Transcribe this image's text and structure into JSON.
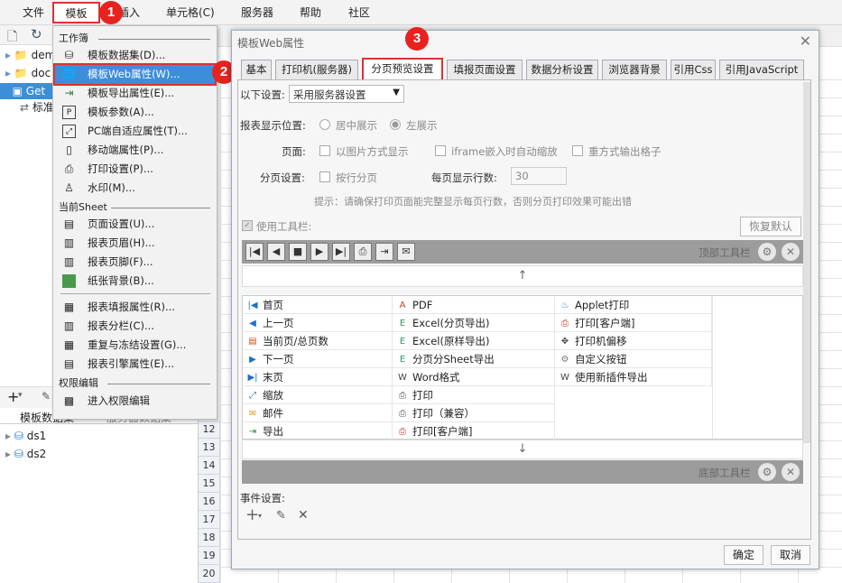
{
  "menubar": {
    "items": [
      "文件",
      "模板",
      "插入",
      "单元格(C)",
      "服务器",
      "帮助",
      "社区"
    ]
  },
  "callouts": [
    "1",
    "2",
    "3"
  ],
  "left": {
    "tree": [
      "dem",
      "doc",
      "Get",
      "标准"
    ],
    "tabs": [
      "模板数据集",
      "服务器数据集"
    ],
    "datasets": [
      "ds1",
      "ds2"
    ]
  },
  "sheet": {
    "rows": [
      "12",
      "13",
      "14",
      "15",
      "16",
      "17",
      "18",
      "19",
      "20"
    ]
  },
  "menu": {
    "section_workbook": "工作簿",
    "workbook_items": [
      {
        "label": "模板数据集(D)...",
        "icon": "database-icon"
      },
      {
        "label": "模板Web属性(W)...",
        "icon": "globe-icon"
      },
      {
        "label": "模板导出属性(E)...",
        "icon": "export-icon"
      },
      {
        "label": "模板参数(A)...",
        "icon": "param-icon"
      },
      {
        "label": "PC端自适应属性(T)...",
        "icon": "adapt-icon"
      },
      {
        "label": "移动端属性(P)...",
        "icon": "mobile-icon"
      },
      {
        "label": "打印设置(P)...",
        "icon": "printer-icon"
      },
      {
        "label": "水印(M)...",
        "icon": "stamp-icon"
      }
    ],
    "section_sheet": "当前Sheet",
    "sheet_items": [
      {
        "label": "页面设置(U)...",
        "icon": "page-icon"
      },
      {
        "label": "报表页眉(H)...",
        "icon": "header-icon"
      },
      {
        "label": "报表页脚(F)...",
        "icon": "footer-icon"
      },
      {
        "label": "纸张背景(B)...",
        "icon": "picture-icon"
      }
    ],
    "sheet_items2": [
      {
        "label": "报表填报属性(R)...",
        "icon": "form-icon"
      },
      {
        "label": "报表分栏(C)...",
        "icon": "columns-icon"
      },
      {
        "label": "重复与冻结设置(G)...",
        "icon": "freeze-icon"
      },
      {
        "label": "报表引擎属性(E)...",
        "icon": "engine-icon"
      }
    ],
    "section_perm": "权限编辑",
    "perm_item": {
      "label": "进入权限编辑",
      "icon": "permission-icon"
    }
  },
  "dialog": {
    "title": "模板Web属性",
    "tabs": [
      "基本",
      "打印机(服务器)",
      "分页预览设置",
      "填报页面设置",
      "数据分析设置",
      "浏览器背景",
      "引用Css",
      "引用JavaScript"
    ],
    "below_label": "以下设置:",
    "below_value": "采用服务器设置",
    "position_label": "报表显示位置:",
    "pos_center": "居中展示",
    "pos_left": "左展示",
    "page_label": "页面:",
    "page_img": "以图片方式显示",
    "page_iframe": "iframe嵌入时自动缩放",
    "page_repeat": "重方式输出格子",
    "paging_label": "分页设置:",
    "paging_row": "按行分页",
    "rows_label": "每页显示行数:",
    "rows_value": "30",
    "hint": "提示：请确保打印页面能完整显示每页行数，否则分页打印效果可能出错",
    "use_toolbar": "使用工具栏:",
    "restore": "恢复默认",
    "top_toolbar": "顶部工具栏",
    "bottom_toolbar": "底部工具栏",
    "event_label": "事件设置:",
    "ok": "确定",
    "cancel": "取消",
    "grid_col1": [
      {
        "label": "首页",
        "icon": "first-page-icon"
      },
      {
        "label": "上一页",
        "icon": "prev-page-icon"
      },
      {
        "label": "当前页/总页数",
        "icon": "page-count-icon"
      },
      {
        "label": "下一页",
        "icon": "next-page-icon"
      },
      {
        "label": "末页",
        "icon": "last-page-icon"
      },
      {
        "label": "缩放",
        "icon": "zoom-icon"
      },
      {
        "label": "邮件",
        "icon": "mail-icon"
      },
      {
        "label": "导出",
        "icon": "export-icon"
      }
    ],
    "grid_col2": [
      {
        "label": "PDF",
        "icon": "pdf-icon"
      },
      {
        "label": "Excel(分页导出)",
        "icon": "excel-icon"
      },
      {
        "label": "Excel(原样导出)",
        "icon": "excel-icon"
      },
      {
        "label": "分页分Sheet导出",
        "icon": "excel-icon"
      },
      {
        "label": "Word格式",
        "icon": "word-icon"
      },
      {
        "label": "打印",
        "icon": "printer-icon"
      },
      {
        "label": "打印（兼容）",
        "icon": "printer-icon"
      },
      {
        "label": "打印[客户端]",
        "icon": "client-print-icon"
      }
    ],
    "grid_col3": [
      {
        "label": "Applet打印",
        "icon": "applet-icon"
      },
      {
        "label": "打印[客户端]",
        "icon": "client-print-icon"
      },
      {
        "label": "打印机偏移",
        "icon": "move-icon"
      },
      {
        "label": "自定义按钮",
        "icon": "gear-icon"
      },
      {
        "label": "使用新插件导出",
        "icon": "word-icon"
      }
    ]
  }
}
